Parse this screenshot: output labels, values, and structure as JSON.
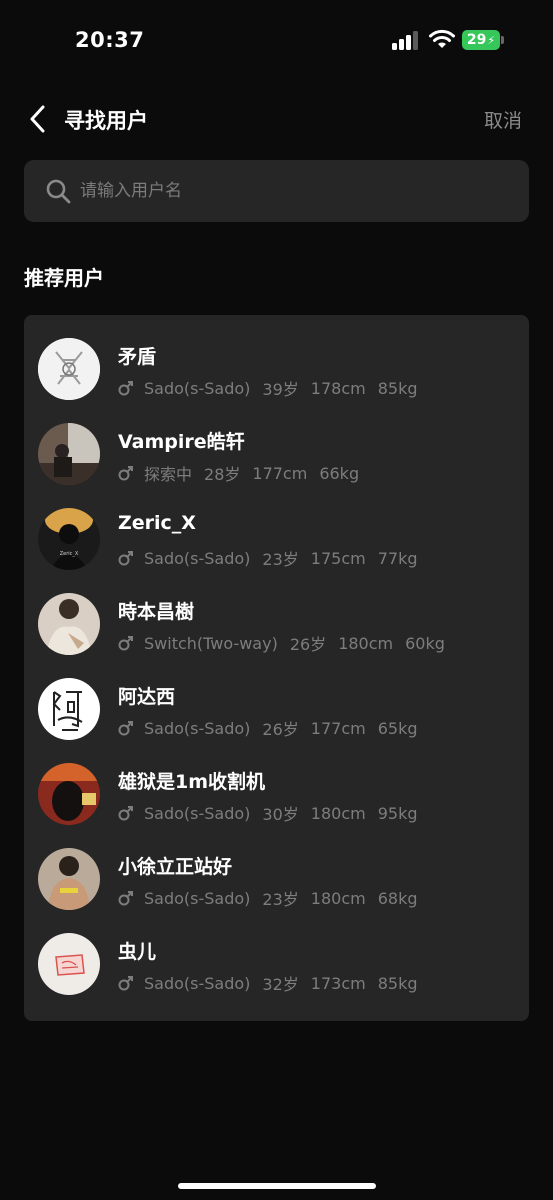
{
  "status_bar": {
    "time": "20:37",
    "battery": "29"
  },
  "header": {
    "title": "寻找用户",
    "cancel_label": "取消"
  },
  "search": {
    "placeholder": "请输入用户名",
    "value": ""
  },
  "section_title": "推荐用户",
  "users": [
    {
      "name": "矛盾",
      "role": "Sado(s-Sado)",
      "age": "39岁",
      "height": "178cm",
      "weight": "85kg",
      "avatar": "sketch-avatar"
    },
    {
      "name": "Vampire皓轩",
      "role": "探索中",
      "age": "28岁",
      "height": "177cm",
      "weight": "66kg",
      "avatar": "photo-avatar"
    },
    {
      "name": "Zeric_X",
      "role": "Sado(s-Sado)",
      "age": "23岁",
      "height": "175cm",
      "weight": "77kg",
      "avatar": "silhouette-avatar"
    },
    {
      "name": "時本昌樹",
      "role": "Switch(Two-way)",
      "age": "26岁",
      "height": "180cm",
      "weight": "60kg",
      "avatar": "photo-avatar"
    },
    {
      "name": "阿达西",
      "role": "Sado(s-Sado)",
      "age": "26岁",
      "height": "177cm",
      "weight": "65kg",
      "avatar": "calligraphy-avatar"
    },
    {
      "name": "雄狱是1m收割机",
      "role": "Sado(s-Sado)",
      "age": "30岁",
      "height": "180cm",
      "weight": "95kg",
      "avatar": "photo-avatar"
    },
    {
      "name": "小徐立正站好",
      "role": "Sado(s-Sado)",
      "age": "23岁",
      "height": "180cm",
      "weight": "68kg",
      "avatar": "photo-avatar"
    },
    {
      "name": "虫儿",
      "role": "Sado(s-Sado)",
      "age": "32岁",
      "height": "173cm",
      "weight": "85kg",
      "avatar": "stamp-avatar"
    }
  ],
  "colors": {
    "background": "#0b0b0b",
    "card": "#262626",
    "secondary_text": "#7d7d7d",
    "battery": "#35c759"
  }
}
